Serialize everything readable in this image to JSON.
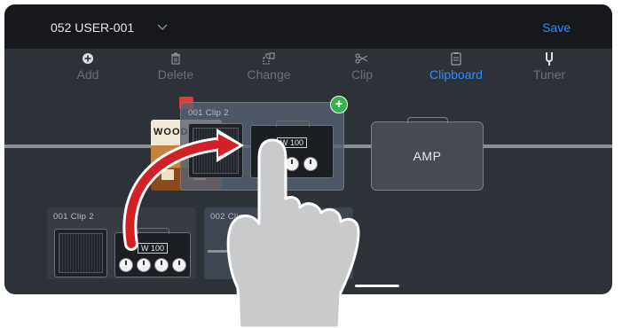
{
  "header": {
    "preset_name": "052 USER-001",
    "save_label": "Save"
  },
  "toolbar": [
    {
      "label": "Add",
      "icon": "plus-circle-icon",
      "active": false
    },
    {
      "label": "Delete",
      "icon": "trash-icon",
      "active": false
    },
    {
      "label": "Change",
      "icon": "swap-icon",
      "active": false
    },
    {
      "label": "Clip",
      "icon": "scissors-icon",
      "active": false
    },
    {
      "label": "Clipboard",
      "icon": "clipboard-icon",
      "active": true
    },
    {
      "label": "Tuner",
      "icon": "tuning-fork-icon",
      "active": false
    }
  ],
  "chain": {
    "pedal_sign": "WOODY",
    "amp_label": "AMP"
  },
  "dragging_clip": {
    "title": "001  Clip 2",
    "amp_label": "W 100"
  },
  "clipboard": [
    {
      "title": "001  Clip 2",
      "amp_label": "W 100"
    },
    {
      "title": "002  Clip"
    }
  ],
  "colors": {
    "accent": "#2f8cff",
    "add_badge": "#35b24a",
    "drag_arrow": "#d32027"
  }
}
